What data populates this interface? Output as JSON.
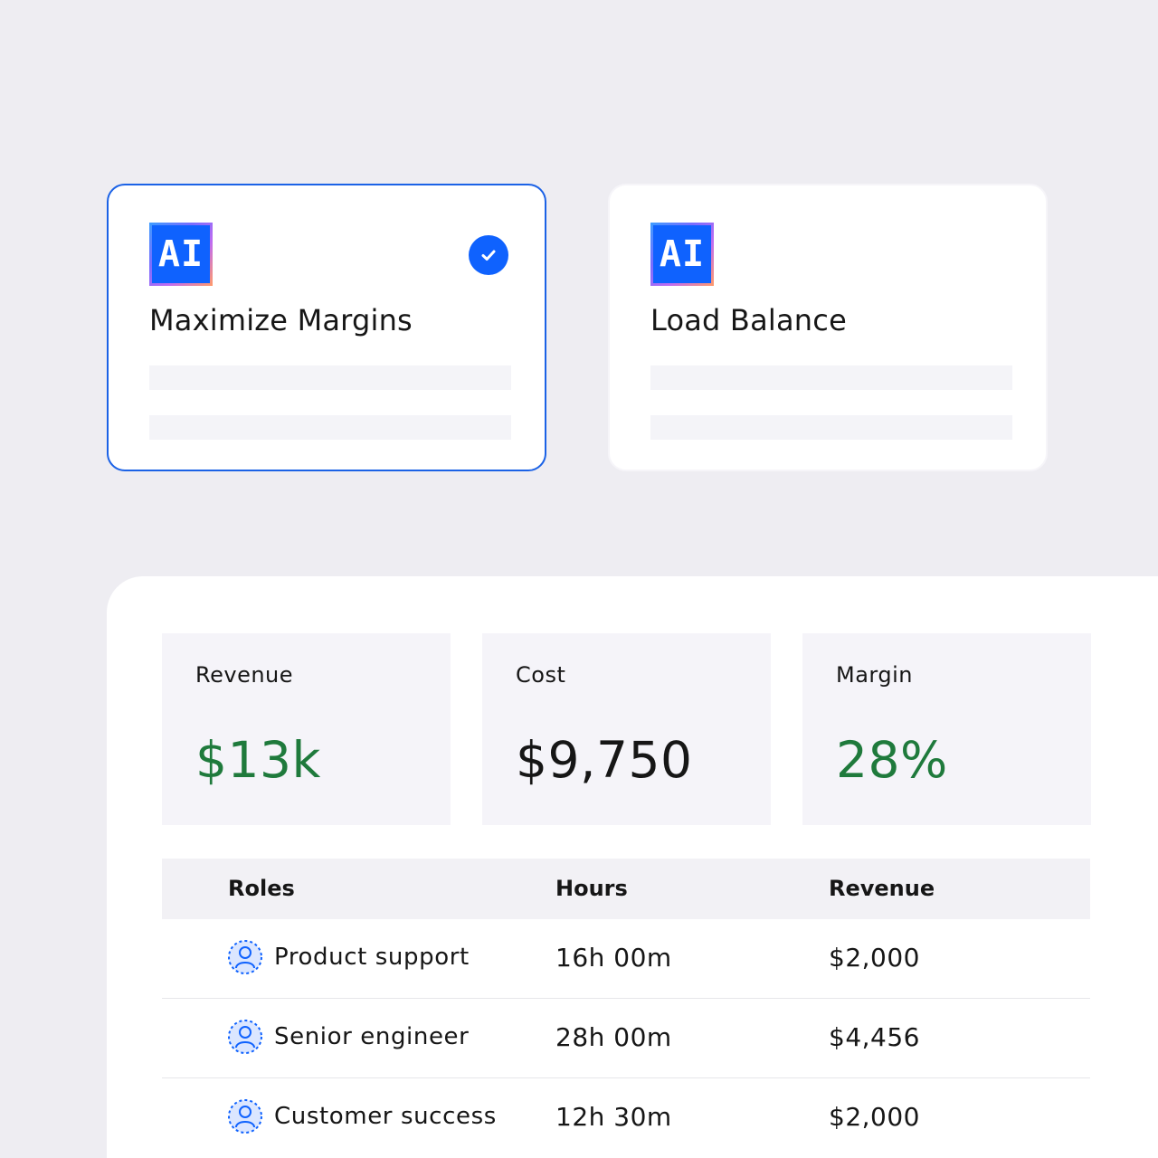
{
  "options": [
    {
      "badge": "AI",
      "title": "Maximize Margins",
      "selected": true
    },
    {
      "badge": "AI",
      "title": "Load Balance",
      "selected": false
    }
  ],
  "metrics": [
    {
      "label": "Revenue",
      "value": "$13k",
      "color": "#1f7a3c"
    },
    {
      "label": "Cost",
      "value": "$9,750",
      "color": "#161616"
    },
    {
      "label": "Margin",
      "value": "28%",
      "color": "#1f7a3c"
    }
  ],
  "table": {
    "headers": {
      "roles": "Roles",
      "hours": "Hours",
      "revenue": "Revenue"
    },
    "rows": [
      {
        "role": "Product support",
        "hours": "16h 00m",
        "revenue": "$2,000",
        "icon": "user-icon"
      },
      {
        "role": "Senior engineer",
        "hours": "28h 00m",
        "revenue": "$4,456",
        "icon": "user-icon"
      },
      {
        "role": "Customer success",
        "hours": "12h 30m",
        "revenue": "$2,000",
        "icon": "user-icon"
      }
    ]
  },
  "colors": {
    "accent": "#0f62fe",
    "positive": "#1f7a3c",
    "background": "#eeedf2"
  }
}
